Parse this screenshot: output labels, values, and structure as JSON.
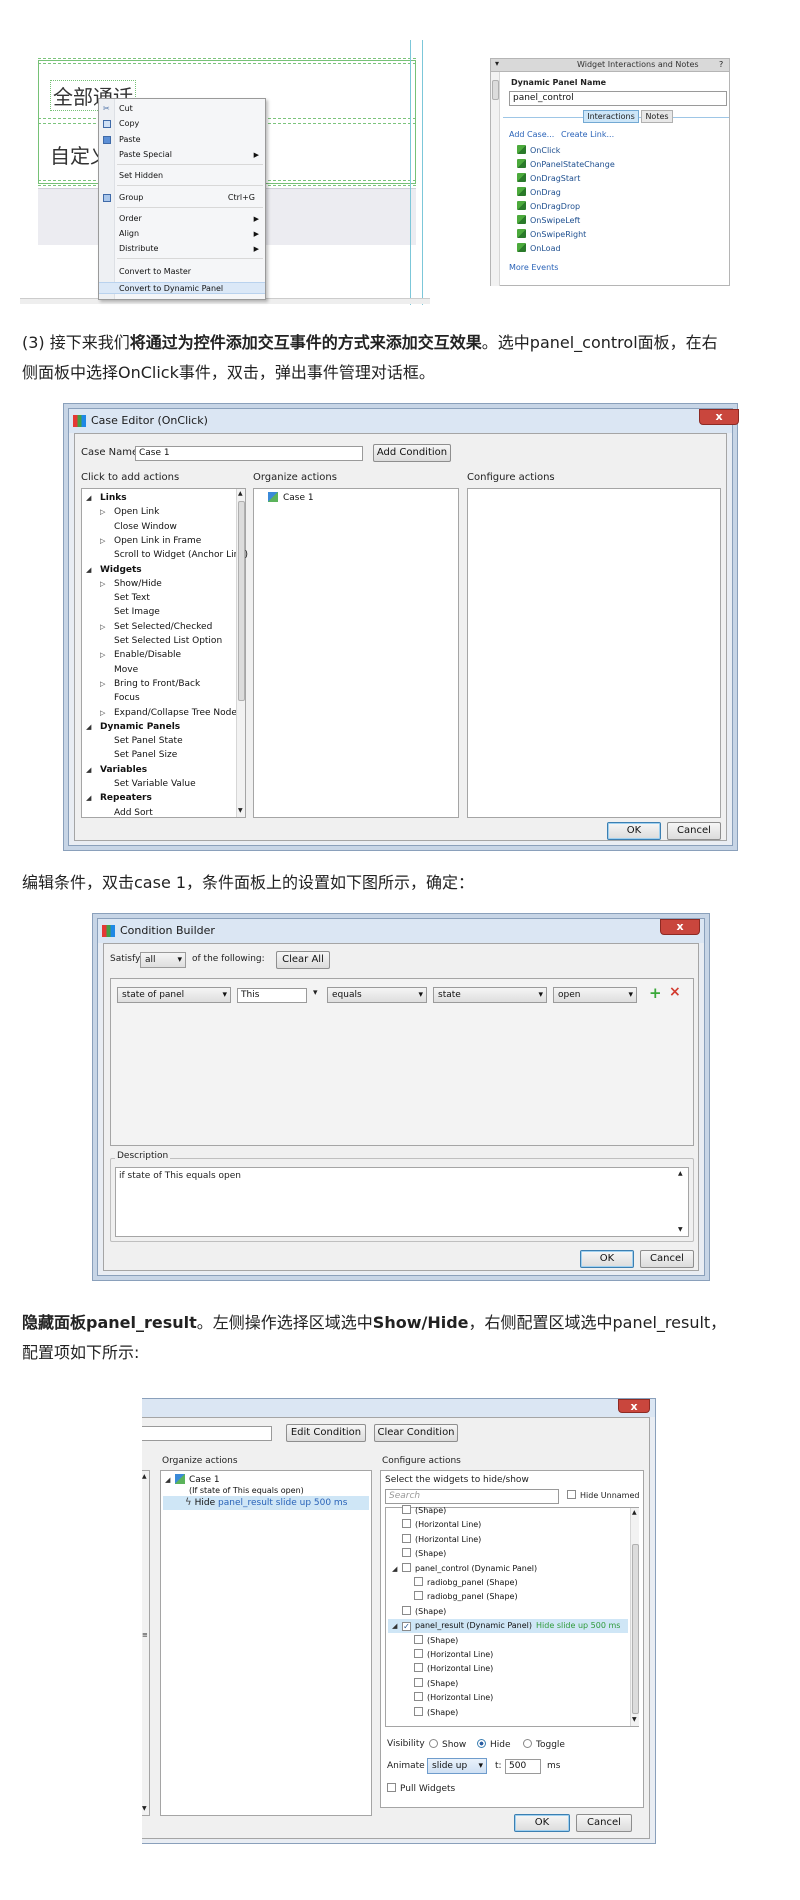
{
  "fig1": {
    "canvas_text_1": "全部通话",
    "canvas_text_2": "自定义",
    "context_menu": [
      {
        "label": "Cut",
        "icon": "cut-icon"
      },
      {
        "label": "Copy",
        "icon": "copy-icon"
      },
      {
        "label": "Paste",
        "icon": "paste-icon"
      },
      {
        "label": "Paste Special",
        "submenu": true
      },
      {
        "label": "Set Hidden"
      },
      {
        "label": "Group",
        "shortcut": "Ctrl+G",
        "icon": "group-icon"
      },
      {
        "label": "Order",
        "submenu": true
      },
      {
        "label": "Align",
        "submenu": true
      },
      {
        "label": "Distribute",
        "submenu": true
      },
      {
        "label": "Convert to Master"
      },
      {
        "label": "Convert to Dynamic Panel"
      }
    ],
    "interactions_panel": {
      "title": "Widget Interactions and Notes",
      "help": "?",
      "name_label": "Dynamic Panel Name",
      "name_value": "panel_control",
      "tab_interactions": "Interactions",
      "tab_notes": "Notes",
      "add_case": "Add Case...",
      "create_link": "Create Link...",
      "events": [
        "OnClick",
        "OnPanelStateChange",
        "OnDragStart",
        "OnDrag",
        "OnDragDrop",
        "OnSwipeLeft",
        "OnSwipeRight",
        "OnLoad"
      ],
      "more_events": "More Events"
    }
  },
  "para1": {
    "prefix": "(3) 接下来我们",
    "bold": "将通过为控件添加交互事件的方式来添加交互效果",
    "rest_line1": "。选中panel_control面板，在右",
    "line2": "侧面板中选择OnClick事件，双击，弹出事件管理对话框。"
  },
  "case_editor": {
    "title": "Case Editor (OnClick)",
    "close": "x",
    "case_name_label": "Case Name",
    "case_name_value": "Case 1",
    "add_condition": "Add Condition",
    "col1_label": "Click to add actions",
    "col2_label": "Organize actions",
    "col3_label": "Configure actions",
    "actions": [
      {
        "label": "Links",
        "level": 0,
        "group": true
      },
      {
        "label": "Open Link",
        "level": 1,
        "tri": true
      },
      {
        "label": "Close Window",
        "level": 1
      },
      {
        "label": "Open Link in Frame",
        "level": 1,
        "tri": true
      },
      {
        "label": "Scroll to Widget (Anchor Link)",
        "level": 1
      },
      {
        "label": "Widgets",
        "level": 0,
        "group": true
      },
      {
        "label": "Show/Hide",
        "level": 1,
        "tri": true
      },
      {
        "label": "Set Text",
        "level": 1
      },
      {
        "label": "Set Image",
        "level": 1
      },
      {
        "label": "Set Selected/Checked",
        "level": 1,
        "tri": true
      },
      {
        "label": "Set Selected List Option",
        "level": 1
      },
      {
        "label": "Enable/Disable",
        "level": 1,
        "tri": true
      },
      {
        "label": "Move",
        "level": 1
      },
      {
        "label": "Bring to Front/Back",
        "level": 1,
        "tri": true
      },
      {
        "label": "Focus",
        "level": 1
      },
      {
        "label": "Expand/Collapse Tree Node",
        "level": 1,
        "tri": true
      },
      {
        "label": "Dynamic Panels",
        "level": 0,
        "group": true
      },
      {
        "label": "Set Panel State",
        "level": 1
      },
      {
        "label": "Set Panel Size",
        "level": 1
      },
      {
        "label": "Variables",
        "level": 0,
        "group": true
      },
      {
        "label": "Set Variable Value",
        "level": 1
      },
      {
        "label": "Repeaters",
        "level": 0,
        "group": true
      },
      {
        "label": "Add Sort",
        "level": 1
      }
    ],
    "organize_case": "Case 1",
    "ok": "OK",
    "cancel": "Cancel"
  },
  "para2": "编辑条件，双击case 1，条件面板上的设置如下图所示，确定：",
  "condition_builder": {
    "title": "Condition Builder",
    "close": "x",
    "satisfy_label": "Satisfy",
    "satisfy_value": "all",
    "of_following": "of the following:",
    "clear_all": "Clear All",
    "cond_1": "state of panel",
    "cond_2": "This",
    "cond_3": "equals",
    "cond_4": "state",
    "cond_5": "open",
    "add": "+",
    "remove": "×",
    "description_label": "Description",
    "description_text": "if state of This equals open",
    "ok": "OK",
    "cancel": "Cancel"
  },
  "para3": {
    "bold1": "隐藏面板panel_result",
    "mid": "。左侧操作选择区域选中",
    "bold2": "Show/Hide",
    "rest": "，右侧配置区域选中panel_result，",
    "line2": "配置项如下所示:"
  },
  "fig4": {
    "close": "x",
    "edit_condition": "Edit Condition",
    "clear_condition": "Clear Condition",
    "organize_label": "Organize actions",
    "configure_label": "Configure actions",
    "case_name": "Case 1",
    "case_condition": "(If state of This equals open)",
    "action_hide": "Hide",
    "action_detail": "panel_result slide up 500 ms",
    "select_label": "Select the widgets to hide/show",
    "search_placeholder": "Search",
    "hide_unnamed": "Hide Unnamed",
    "widgets": [
      {
        "label": "(Shape)",
        "level": 1
      },
      {
        "label": "(Horizontal Line)",
        "level": 1
      },
      {
        "label": "(Horizontal Line)",
        "level": 1
      },
      {
        "label": "(Shape)",
        "level": 1
      },
      {
        "label": "panel_control (Dynamic Panel)",
        "level": 0,
        "tri": true
      },
      {
        "label": "radiobg_panel (Shape)",
        "level": 2
      },
      {
        "label": "radiobg_panel (Shape)",
        "level": 2
      },
      {
        "label": "(Shape)",
        "level": 1
      },
      {
        "label": "panel_result (Dynamic Panel)",
        "level": 0,
        "tri": true,
        "checked": true,
        "selected": true,
        "note": "Hide slide up 500 ms"
      },
      {
        "label": "(Shape)",
        "level": 2
      },
      {
        "label": "(Horizontal Line)",
        "level": 2
      },
      {
        "label": "(Horizontal Line)",
        "level": 2
      },
      {
        "label": "(Shape)",
        "level": 2
      },
      {
        "label": "(Horizontal Line)",
        "level": 2
      },
      {
        "label": "(Shape)",
        "level": 2
      }
    ],
    "visibility_label": "Visibility",
    "opt_show": "Show",
    "opt_hide": "Hide",
    "opt_toggle": "Toggle",
    "animate_label": "Animate",
    "animate_value": "slide up",
    "t_label": "t:",
    "t_value": "500",
    "ms": "ms",
    "pull_widgets": "Pull Widgets",
    "ok": "OK",
    "cancel": "Cancel"
  }
}
